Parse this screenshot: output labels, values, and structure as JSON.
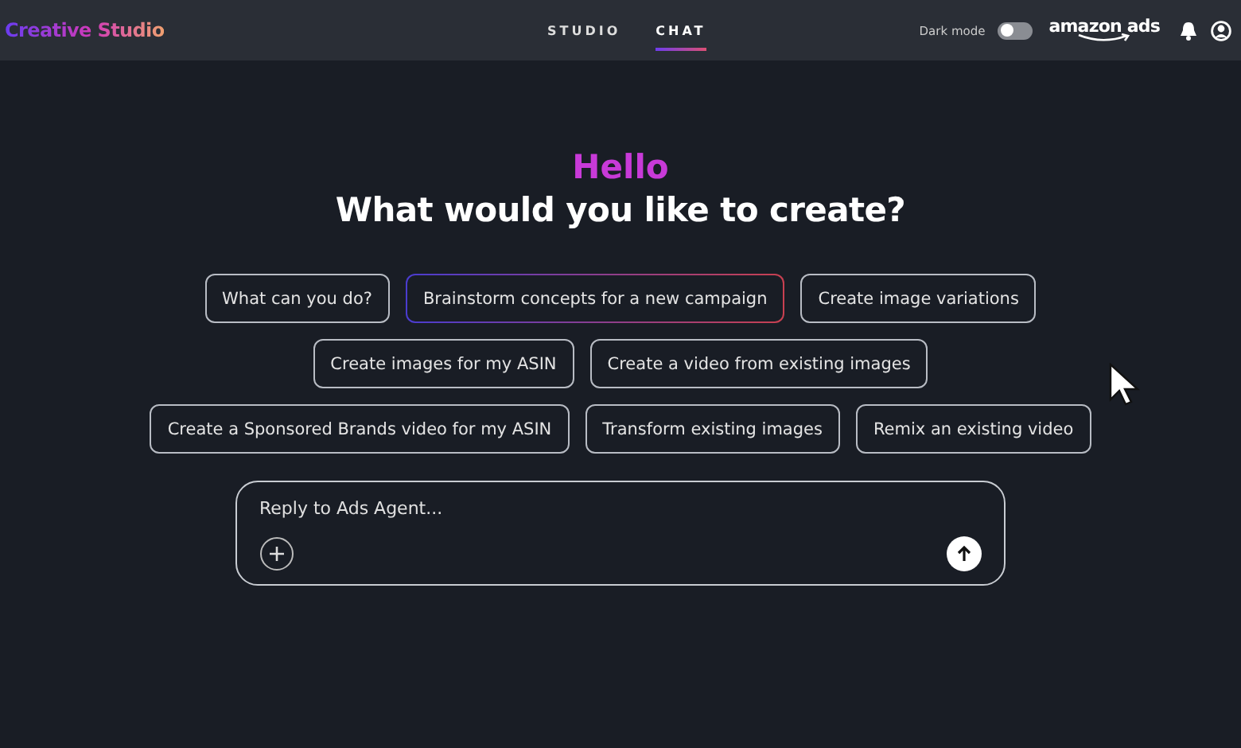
{
  "header": {
    "brand": "Creative Studio",
    "tabs": [
      {
        "label": "STUDIO",
        "selected": false
      },
      {
        "label": "CHAT",
        "selected": true
      }
    ],
    "dark_mode": {
      "label": "Dark mode",
      "on": false
    },
    "partner_logo": "amazon ads"
  },
  "greeting": {
    "hello": "Hello",
    "question": "What would you like to create?"
  },
  "suggestion_rows": [
    [
      {
        "label": "What can you do?",
        "selected": false
      },
      {
        "label": "Brainstorm concepts for a new campaign",
        "selected": true
      },
      {
        "label": "Create image variations",
        "selected": false
      }
    ],
    [
      {
        "label": "Create images for my ASIN",
        "selected": false
      },
      {
        "label": "Create a video from existing images",
        "selected": false
      }
    ],
    [
      {
        "label": "Create a Sponsored Brands video for my ASIN",
        "selected": false
      },
      {
        "label": "Transform existing images",
        "selected": false
      },
      {
        "label": "Remix an existing video",
        "selected": false
      }
    ]
  ],
  "composer": {
    "placeholder": "Reply to Ads Agent..."
  }
}
